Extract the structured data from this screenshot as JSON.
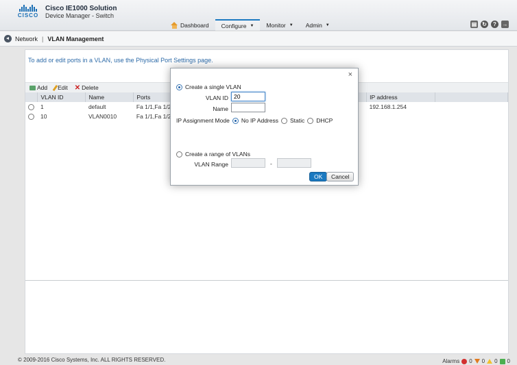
{
  "header": {
    "logo_text": "CISCO",
    "title": "Cisco IE1000 Solution",
    "subtitle": "Device Manager - Switch",
    "nav": [
      {
        "label": "Dashboard"
      },
      {
        "label": "Configure"
      },
      {
        "label": "Monitor"
      },
      {
        "label": "Admin"
      }
    ]
  },
  "breadcrumb": {
    "parent": "Network",
    "separator": "|",
    "current": "VLAN Management"
  },
  "page": {
    "info": "To add or edit ports in a VLAN, use the Physical Port Settings page.",
    "toolbar": {
      "add": "Add",
      "edit": "Edit",
      "delete": "Delete"
    },
    "table": {
      "columns": [
        "VLAN ID",
        "Name",
        "Ports",
        "",
        "IP address"
      ],
      "rows": [
        {
          "vlan_id": "1",
          "name": "default",
          "ports": "Fa 1/1,Fa 1/2",
          "ip": "192.168.1.254"
        },
        {
          "vlan_id": "10",
          "name": "VLAN0010",
          "ports": "Fa 1/1,Fa 1/2",
          "ip": ""
        }
      ]
    }
  },
  "dialog": {
    "close": "×",
    "single_label": "Create a single VLAN",
    "vlan_id_label": "VLAN ID",
    "vlan_id_value": "20",
    "name_label": "Name",
    "name_value": "",
    "ip_mode_label": "IP Assignment Mode",
    "ip_modes": [
      "No IP Address",
      "Static",
      "DHCP"
    ],
    "range_label": "Create a range of VLANs",
    "vlan_range_label": "VLAN Range",
    "range_sep": "-",
    "ok": "OK",
    "cancel": "Cancel"
  },
  "footer": {
    "copyright": "© 2009-2016 Cisco Systems, Inc. ALL RIGHTS RESERVED.",
    "alarms_label": "Alarms",
    "alarm_counts": [
      "0",
      "0",
      "0",
      "0"
    ]
  }
}
